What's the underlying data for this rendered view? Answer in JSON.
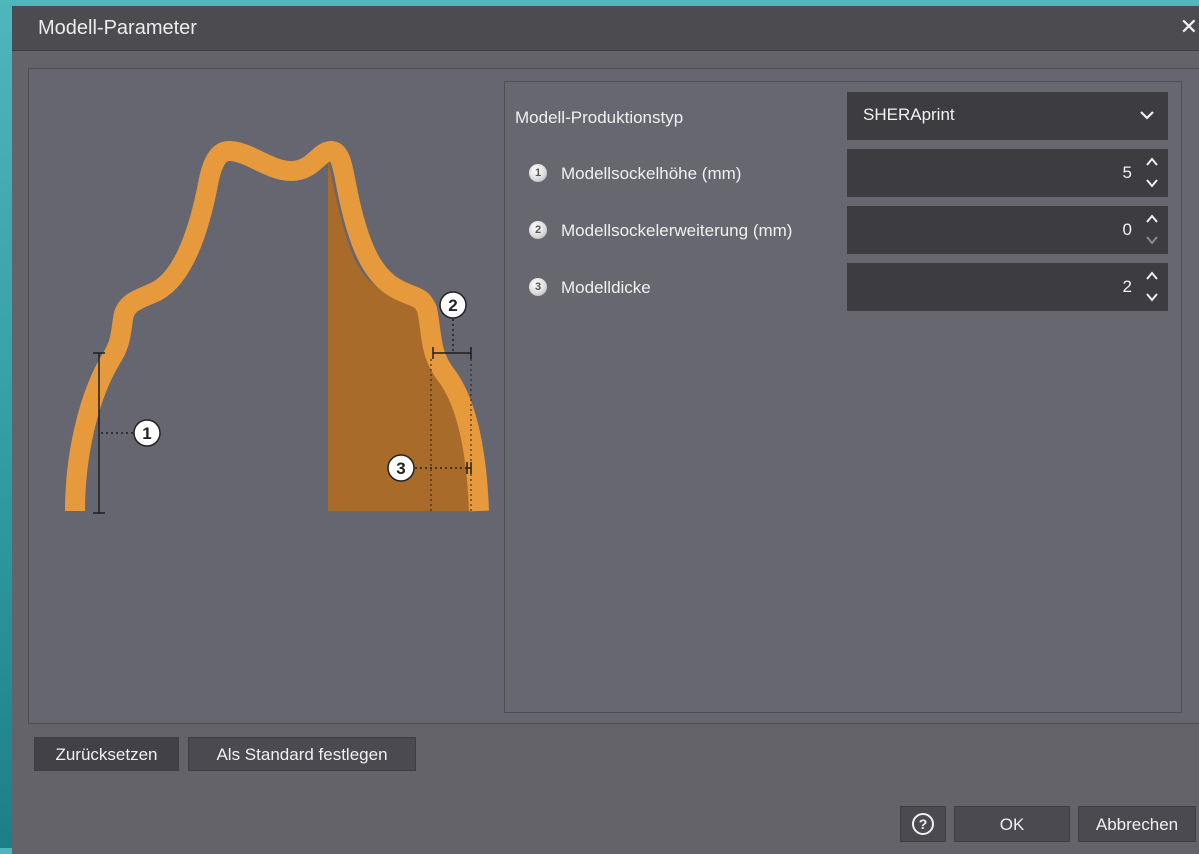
{
  "dialog": {
    "title": "Modell-Parameter",
    "close_glyph": "✕"
  },
  "illustration": {
    "markers": [
      "1",
      "2",
      "3"
    ],
    "colors": {
      "base": "#e79a3c",
      "fill": "#a86b2a",
      "line": "#1e1e1e"
    }
  },
  "params": {
    "production_type": {
      "label": "Modell-Produktionstyp",
      "value": "SHERAprint"
    },
    "base_height": {
      "badge": "1",
      "label": "Modellsockelhöhe (mm)",
      "value": "5"
    },
    "base_extension": {
      "badge": "2",
      "label": "Modellsockelerweiterung (mm)",
      "value": "0"
    },
    "thickness": {
      "badge": "3",
      "label": "Modelldicke",
      "value": "2"
    }
  },
  "buttons": {
    "reset": "Zurücksetzen",
    "set_default": "Als Standard festlegen",
    "help": "?",
    "ok": "OK",
    "cancel": "Abbrechen"
  }
}
